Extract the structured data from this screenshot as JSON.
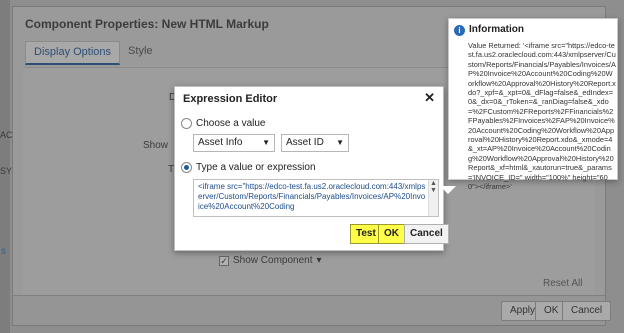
{
  "background": {
    "left_labels": [
      "AC IN",
      "SYRA"
    ],
    "bottom_left": "s",
    "bottom_left2": "N"
  },
  "component_properties": {
    "title": "Component Properties: New HTML Markup",
    "tabs": [
      {
        "label": "Display Options"
      },
      {
        "label": "Style"
      }
    ],
    "labels": {
      "desc": "Desc",
      "show": "Show",
      "trun": "Trun"
    },
    "show_component": "Show Component",
    "reset_all": "Reset All",
    "buttons": {
      "apply": "Apply",
      "ok": "OK",
      "cancel": "Cancel"
    }
  },
  "expression_editor": {
    "title": "Expression Editor",
    "close_glyph": "✕",
    "choose_value_label": "Choose a value",
    "type_value_label": "Type a value or expression",
    "dropdown_1": "Asset Info",
    "dropdown_2": "Asset ID",
    "expression_text": "<iframe src=\"https://edco-test.fa.us2.oraclecloud.com:443/xmlpserver/Custom/Reports/Financials/Payables/Invoices/AP%20Invoice%20Account%20Coding",
    "buttons": {
      "test": "Test",
      "ok": "OK",
      "cancel": "Cancel"
    }
  },
  "information": {
    "title": "Information",
    "text": "Value Returned: '<iframe src=\"https://edco-test.fa.us2.oraclecloud.com:443/xmlpserver/Custom/Reports/Financials/Payables/Invoices/AP%20Invoice%20Account%20Coding%20Workflow%20Approval%20History%20Report.xdo?_xpf=&_xpt=0&_dFlag=false&_edIndex=0&_dx=0&_rToken=&_ranDiag=false&_xdo=%2FCustom%2FReports%2FFinancials%2FPayables%2FInvoices%2FAP%20Invoice%20Account%20Coding%20Workflow%20Approval%20History%20Report.xdo&_xmode=4&_xt=AP%20Invoice%20Account%20Coding%20Workflow%20Approval%20History%20Report&_xf=html&_xautorun=true&_params='INVOICE_ID=\" width=\"100%\" height=\"600\"></iframe>'"
  },
  "colors": {
    "highlight_button": "#ffff4a",
    "info_icon": "#2a68b8",
    "link_blue": "#1c4c8c"
  }
}
